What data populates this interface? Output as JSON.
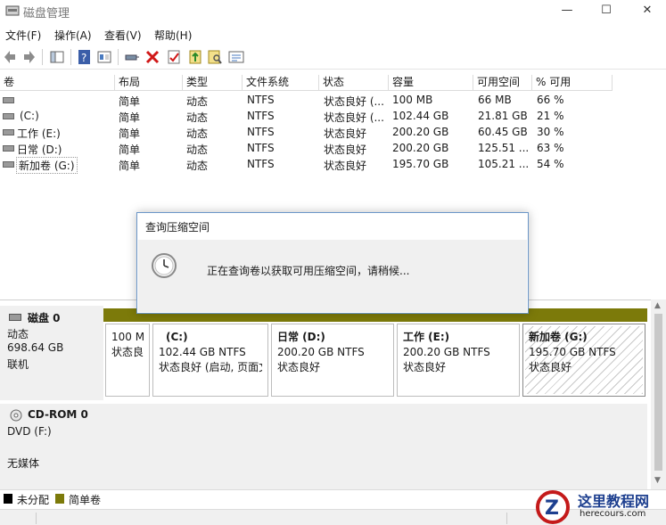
{
  "window": {
    "title": "磁盘管理",
    "minimize": "—",
    "maximize": "☐",
    "close": "✕"
  },
  "menu": [
    "文件(F)",
    "操作(A)",
    "查看(V)",
    "帮助(H)"
  ],
  "toolbar": [
    "back-icon",
    "forward-icon",
    "console-tree-icon",
    "help-icon",
    "view-icon",
    "connect-icon",
    "delete-icon",
    "properties-icon",
    "export-icon",
    "search-icon",
    "list-icon"
  ],
  "volumes": {
    "headers": [
      "卷",
      "布局",
      "类型",
      "文件系统",
      "状态",
      "容量",
      "可用空间",
      "% 可用"
    ],
    "rows": [
      [
        "",
        "简单",
        "动态",
        "NTFS",
        "状态良好 (...",
        "100 MB",
        "66 MB",
        "66 %"
      ],
      [
        "(C:)",
        "简单",
        "动态",
        "NTFS",
        "状态良好 (...",
        "102.44 GB",
        "21.81 GB",
        "21 %"
      ],
      [
        "工作 (E:)",
        "简单",
        "动态",
        "NTFS",
        "状态良好",
        "200.20 GB",
        "60.45 GB",
        "30 %"
      ],
      [
        "日常 (D:)",
        "简单",
        "动态",
        "NTFS",
        "状态良好",
        "200.20 GB",
        "125.51 ...",
        "63 %"
      ],
      [
        "新加卷 (G:)",
        "简单",
        "动态",
        "NTFS",
        "状态良好",
        "195.70 GB",
        "105.21 ...",
        "54 %"
      ]
    ]
  },
  "disks": [
    {
      "name": "磁盘 0",
      "type": "动态",
      "size": "698.64 GB",
      "state": "联机",
      "partitions": [
        {
          "name": "",
          "size": "100 M",
          "status": "状态良"
        },
        {
          "name": "(C:)",
          "size": "102.44 GB NTFS",
          "status": "状态良好 (启动, 页面文"
        },
        {
          "name": "日常  (D:)",
          "size": "200.20 GB NTFS",
          "status": "状态良好"
        },
        {
          "name": "工作  (E:)",
          "size": "200.20 GB NTFS",
          "status": "状态良好"
        },
        {
          "name": "新加卷  (G:)",
          "size": "195.70 GB NTFS",
          "status": "状态良好"
        }
      ]
    },
    {
      "name": "CD-ROM 0",
      "type": "DVD (F:)",
      "state": "无媒体"
    }
  ],
  "legend": [
    {
      "label": "未分配",
      "color": "#000000"
    },
    {
      "label": "简单卷",
      "color": "#7c7a0a"
    }
  ],
  "dialog": {
    "title": "查询压缩空间",
    "message": "正在查询卷以获取可用压缩空间，请稍候..."
  },
  "watermark": {
    "logo": "Z",
    "title": "这里教程网",
    "url": "herecours.com"
  }
}
